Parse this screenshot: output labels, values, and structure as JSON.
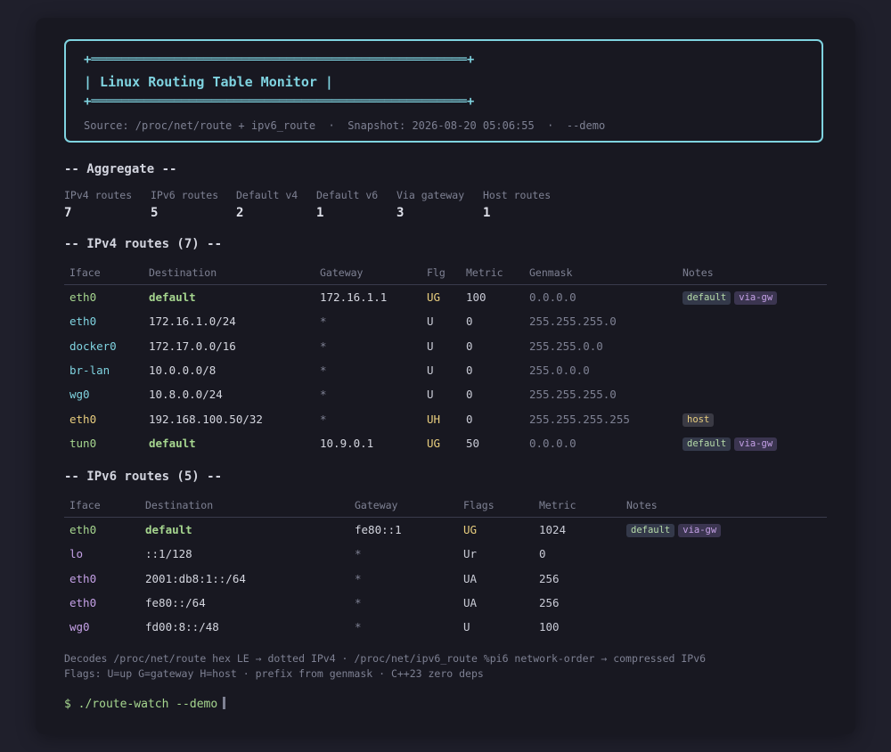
{
  "header": {
    "banner_top": "+══════════════════════════════════════════════════+",
    "title": "| Linux Routing Table Monitor |",
    "banner_bottom": "+══════════════════════════════════════════════════+",
    "source": "Source: /proc/net/route + ipv6_route  ·  Snapshot: 2026-08-20 05:06:55  ·  --demo"
  },
  "aggregate": {
    "heading": "-- Aggregate --",
    "stats": [
      {
        "label": "IPv4 routes",
        "value": "7"
      },
      {
        "label": "IPv6 routes",
        "value": "5"
      },
      {
        "label": "Default v4",
        "value": "2"
      },
      {
        "label": "Default v6",
        "value": "1"
      },
      {
        "label": "Via gateway",
        "value": "3"
      },
      {
        "label": "Host routes",
        "value": "1"
      }
    ]
  },
  "ipv4": {
    "heading": "-- IPv4 routes (7) --",
    "columns": [
      "Iface",
      "Destination",
      "Gateway",
      "Flg",
      "Metric",
      "Genmask",
      "Notes"
    ],
    "rows": [
      {
        "iface": "eth0",
        "iface_color": "green",
        "dest": "default",
        "is_default": true,
        "gateway": "172.16.1.1",
        "flags": "UG",
        "metric": "100",
        "mask": "0.0.0.0",
        "notes": [
          "default",
          "via-gw"
        ]
      },
      {
        "iface": "eth0",
        "iface_color": "cyan",
        "dest": "172.16.1.0/24",
        "is_default": false,
        "gateway": "*",
        "flags": "U",
        "metric": "0",
        "mask": "255.255.255.0",
        "notes": []
      },
      {
        "iface": "docker0",
        "iface_color": "cyan",
        "dest": "172.17.0.0/16",
        "is_default": false,
        "gateway": "*",
        "flags": "U",
        "metric": "0",
        "mask": "255.255.0.0",
        "notes": []
      },
      {
        "iface": "br-lan",
        "iface_color": "cyan",
        "dest": "10.0.0.0/8",
        "is_default": false,
        "gateway": "*",
        "flags": "U",
        "metric": "0",
        "mask": "255.0.0.0",
        "notes": []
      },
      {
        "iface": "wg0",
        "iface_color": "cyan",
        "dest": "10.8.0.0/24",
        "is_default": false,
        "gateway": "*",
        "flags": "U",
        "metric": "0",
        "mask": "255.255.255.0",
        "notes": []
      },
      {
        "iface": "eth0",
        "iface_color": "yellow",
        "dest": "192.168.100.50/32",
        "is_default": false,
        "gateway": "*",
        "flags": "UH",
        "metric": "0",
        "mask": "255.255.255.255",
        "notes": [
          "host"
        ]
      },
      {
        "iface": "tun0",
        "iface_color": "green",
        "dest": "default",
        "is_default": true,
        "gateway": "10.9.0.1",
        "flags": "UG",
        "metric": "50",
        "mask": "0.0.0.0",
        "notes": [
          "default",
          "via-gw"
        ]
      }
    ]
  },
  "ipv6": {
    "heading": "-- IPv6 routes (5) --",
    "columns": [
      "Iface",
      "Destination",
      "Gateway",
      "Flags",
      "Metric",
      "Notes"
    ],
    "rows": [
      {
        "iface": "eth0",
        "iface_color": "green",
        "dest": "default",
        "is_default": true,
        "gateway": "fe80::1",
        "flags": "UG",
        "metric": "1024",
        "notes": [
          "default",
          "via-gw"
        ]
      },
      {
        "iface": "lo",
        "iface_color": "purple",
        "dest": "::1/128",
        "is_default": false,
        "gateway": "*",
        "flags": "Ur",
        "metric": "0",
        "notes": []
      },
      {
        "iface": "eth0",
        "iface_color": "purple",
        "dest": "2001:db8:1::/64",
        "is_default": false,
        "gateway": "*",
        "flags": "UA",
        "metric": "256",
        "notes": []
      },
      {
        "iface": "eth0",
        "iface_color": "purple",
        "dest": "fe80::/64",
        "is_default": false,
        "gateway": "*",
        "flags": "UA",
        "metric": "256",
        "notes": []
      },
      {
        "iface": "wg0",
        "iface_color": "purple",
        "dest": "fd00:8::/48",
        "is_default": false,
        "gateway": "*",
        "flags": "U",
        "metric": "100",
        "notes": []
      }
    ]
  },
  "footer": {
    "line1": "Decodes /proc/net/route hex LE → dotted IPv4 · /proc/net/ipv6_route %pi6 network-order → compressed IPv6",
    "line2": "Flags: U=up G=gateway H=host · prefix from genmask · C++23 zero deps",
    "prompt": "$ ./route-watch --demo"
  }
}
